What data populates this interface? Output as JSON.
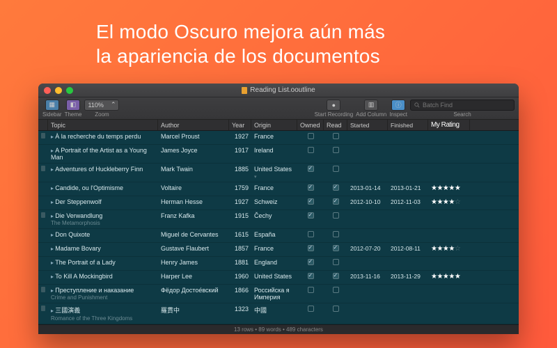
{
  "headline_l1": "El modo Oscuro mejora aún más",
  "headline_l2": "la apariencia de los documentos",
  "window": {
    "title": "Reading List.ooutline"
  },
  "toolbar": {
    "sidebar": "Sidebar",
    "theme": "Theme",
    "zoom_value": "110%",
    "zoom_label": "Zoom",
    "start_recording": "Start Recording",
    "add_column": "Add Column",
    "inspect": "Inspect",
    "search_placeholder": "Batch Find",
    "search_label": "Search"
  },
  "columns": {
    "topic": "Topic",
    "author": "Author",
    "year": "Year",
    "origin": "Origin",
    "owned": "Owned",
    "read": "Read",
    "started": "Started",
    "finished": "Finished",
    "rating": "My Rating"
  },
  "rows": [
    {
      "handle": true,
      "topic": "À la recherche du temps perdu",
      "author": "Marcel Proust",
      "year": "1927",
      "origin": "France",
      "owned": false,
      "read": false,
      "started": "",
      "finished": "",
      "rating": ""
    },
    {
      "handle": false,
      "topic": "A Portrait of the Artist as a Young Man",
      "author": "James Joyce",
      "year": "1917",
      "origin": "Ireland",
      "owned": false,
      "read": false,
      "started": "",
      "finished": "",
      "rating": ""
    },
    {
      "handle": true,
      "topic": "Adventures of Huckleberry Finn",
      "author": "Mark Twain",
      "year": "1885",
      "origin": "United States",
      "origin_tri": true,
      "owned": true,
      "read": false,
      "started": "",
      "finished": "",
      "rating": "",
      "flag": true
    },
    {
      "handle": false,
      "topic": "Candide, ou l'Optimisme",
      "author": "Voltaire",
      "year": "1759",
      "origin": "France",
      "owned": true,
      "read": true,
      "started": "2013-01-14",
      "finished": "2013-01-21",
      "rating": "★★★★★"
    },
    {
      "handle": false,
      "topic": "Der Steppenwolf",
      "author": "Herman Hesse",
      "year": "1927",
      "origin": "Schweiz",
      "owned": true,
      "read": true,
      "started": "2012-10-10",
      "finished": "2012-11-03",
      "rating": "★★★★",
      "rating_empty": "☆"
    },
    {
      "handle": true,
      "topic": "Die Verwandlung",
      "sub": "The Metamorphosis",
      "author": "Franz Kafka",
      "year": "1915",
      "origin": "Čechy",
      "owned": true,
      "read": false,
      "started": "",
      "finished": "",
      "rating": ""
    },
    {
      "handle": false,
      "topic": "Don Quixote",
      "author": "Miguel de Cervantes",
      "year": "1615",
      "origin": "España",
      "owned": false,
      "read": false,
      "started": "",
      "finished": "",
      "rating": ""
    },
    {
      "handle": false,
      "topic": "Madame Bovary",
      "author": "Gustave Flaubert",
      "year": "1857",
      "origin": "France",
      "owned": true,
      "read": true,
      "started": "2012-07-20",
      "finished": "2012-08-11",
      "rating": "★★★★",
      "rating_empty": "☆"
    },
    {
      "handle": false,
      "topic": "The Portrait of a Lady",
      "author": "Henry James",
      "year": "1881",
      "origin": "England",
      "owned": true,
      "read": false,
      "started": "",
      "finished": "",
      "rating": ""
    },
    {
      "handle": false,
      "topic": "To Kill A Mockingbird",
      "author": "Harper Lee",
      "year": "1960",
      "origin": "United States",
      "owned": true,
      "read": true,
      "started": "2013-11-16",
      "finished": "2013-11-29",
      "rating": "★★★★★"
    },
    {
      "handle": true,
      "topic": "Преступление и наказание",
      "sub": "Crime and Punishment",
      "author": "Фёдор Достое́вский",
      "year": "1866",
      "origin": "Российска я Империя",
      "owned": false,
      "read": false,
      "started": "",
      "finished": "",
      "rating": ""
    },
    {
      "handle": true,
      "topic": "三國演義",
      "sub": "Romance of the Three Kingdoms",
      "author": "羅貫中",
      "year": "1323",
      "origin": "中國",
      "owned": false,
      "read": false,
      "started": "",
      "finished": "",
      "rating": ""
    }
  ],
  "footer": "13 rows • 89 words • 489 characters"
}
